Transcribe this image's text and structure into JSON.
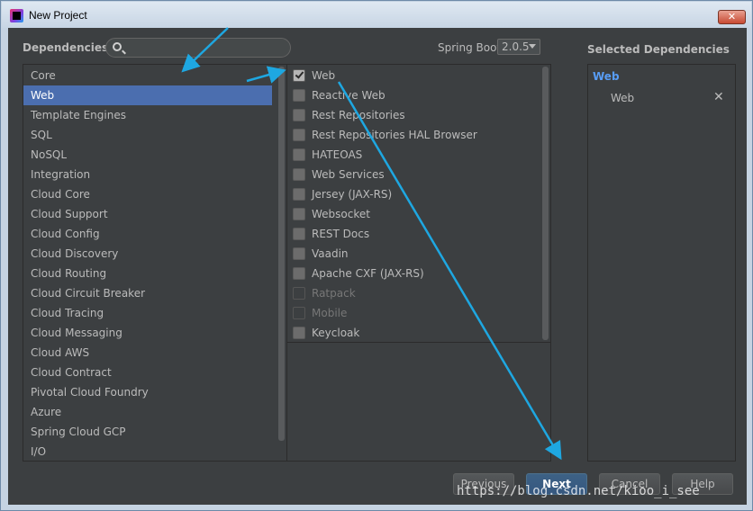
{
  "window": {
    "title": "New Project",
    "close": "✕"
  },
  "header": {
    "dependencies_label": "Dependencies",
    "search_placeholder": "",
    "spring_boot_label": "Spring Boot",
    "spring_boot_version": "2.0.5",
    "selected_header": "Selected Dependencies"
  },
  "categories": [
    {
      "label": "Core"
    },
    {
      "label": "Web",
      "selected": true
    },
    {
      "label": "Template Engines"
    },
    {
      "label": "SQL"
    },
    {
      "label": "NoSQL"
    },
    {
      "label": "Integration"
    },
    {
      "label": "Cloud Core"
    },
    {
      "label": "Cloud Support"
    },
    {
      "label": "Cloud Config"
    },
    {
      "label": "Cloud Discovery"
    },
    {
      "label": "Cloud Routing"
    },
    {
      "label": "Cloud Circuit Breaker"
    },
    {
      "label": "Cloud Tracing"
    },
    {
      "label": "Cloud Messaging"
    },
    {
      "label": "Cloud AWS"
    },
    {
      "label": "Cloud Contract"
    },
    {
      "label": "Pivotal Cloud Foundry"
    },
    {
      "label": "Azure"
    },
    {
      "label": "Spring Cloud GCP"
    },
    {
      "label": "I/O"
    }
  ],
  "dependencies": [
    {
      "label": "Web",
      "checked": true
    },
    {
      "label": "Reactive Web"
    },
    {
      "label": "Rest Repositories"
    },
    {
      "label": "Rest Repositories HAL Browser"
    },
    {
      "label": "HATEOAS"
    },
    {
      "label": "Web Services"
    },
    {
      "label": "Jersey (JAX-RS)"
    },
    {
      "label": "Websocket"
    },
    {
      "label": "REST Docs"
    },
    {
      "label": "Vaadin"
    },
    {
      "label": "Apache CXF (JAX-RS)"
    },
    {
      "label": "Ratpack",
      "disabled": true
    },
    {
      "label": "Mobile",
      "disabled": true
    },
    {
      "label": "Keycloak"
    }
  ],
  "selected": {
    "group": "Web",
    "items": [
      "Web"
    ],
    "remove_glyph": "✕"
  },
  "buttons": {
    "previous": "Previous",
    "next": "Next",
    "cancel": "Cancel",
    "help": "Help"
  },
  "watermark": "https://blog.csdn.net/kioo_i_see",
  "colors": {
    "panel_bg": "#3c3f41",
    "selection": "#4b6eaf",
    "accent_blue": "#589df6",
    "arrow": "#1ea7e1"
  },
  "icons": {
    "app": "intellij-icon",
    "search": "search-icon",
    "remove": "close-icon",
    "dropdown": "chevron-down-icon"
  }
}
